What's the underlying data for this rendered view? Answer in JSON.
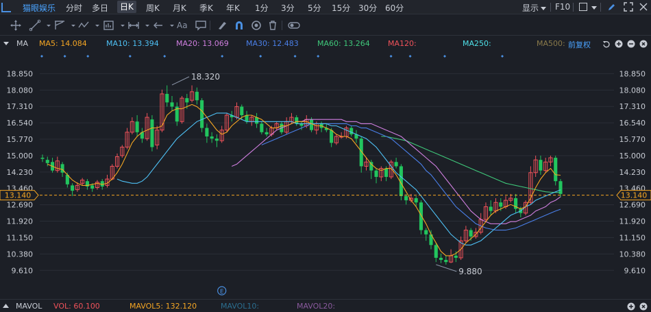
{
  "header": {
    "stock_name": "猫眼娱乐",
    "periods": [
      {
        "label": "分时",
        "active": false
      },
      {
        "label": "多日",
        "active": false
      },
      {
        "label": "日K",
        "active": true
      },
      {
        "label": "周K",
        "active": false
      },
      {
        "label": "月K",
        "active": false
      },
      {
        "label": "季K",
        "active": false
      },
      {
        "label": "年K",
        "active": false
      },
      {
        "label": "1分",
        "active": false
      },
      {
        "label": "3分",
        "active": false
      },
      {
        "label": "5分",
        "active": false
      },
      {
        "label": "15分",
        "active": false
      },
      {
        "label": "30分",
        "active": false
      },
      {
        "label": "60分",
        "active": false
      }
    ],
    "display_label": "显示",
    "f10_label": "F10"
  },
  "toolbar": {
    "tools": [
      "crosshair-icon",
      "line-draw-icon",
      "channel-icon",
      "polyline-icon",
      "measure-icon",
      "range-icon",
      "arrow-icon",
      "text-icon",
      "comment-icon",
      "eraser-icon",
      "magnet-icon",
      "eye-icon",
      "trash-icon",
      "toggle-icon"
    ],
    "text_tool_label": "Aa"
  },
  "ma_legend": {
    "indicator_label": "MA",
    "items": [
      {
        "label": "MA5: 14.084",
        "color": "#f5a623"
      },
      {
        "label": "MA10: 13.394",
        "color": "#4ec1f5"
      },
      {
        "label": "MA20: 13.069",
        "color": "#d07fe0"
      },
      {
        "label": "MA30: 12.483",
        "color": "#4a7fe8"
      },
      {
        "label": "MA60: 13.264",
        "color": "#3fc87a"
      },
      {
        "label": "MA120:",
        "color": "#f0525a"
      },
      {
        "label": "MA250:",
        "color": "#4ee0e8"
      },
      {
        "label": "MA500:",
        "color": "#8a7a4a"
      }
    ],
    "adjust_label": "前复权"
  },
  "volume_legend": {
    "indicator_label": "MAVOL",
    "items": [
      {
        "label": "VOL: 60.100",
        "color": "#f0525a"
      },
      {
        "label": "MAVOL5: 132.120",
        "color": "#f5a623"
      },
      {
        "label": "MAVOL10:",
        "color": "#2b6e8f"
      },
      {
        "label": "MAVOL20:",
        "color": "#8a5a9e"
      }
    ]
  },
  "chart_data": {
    "type": "candlestick",
    "y_ticks": [
      "18.850",
      "18.080",
      "17.310",
      "16.540",
      "15.770",
      "15.000",
      "14.230",
      "13.460",
      "12.690",
      "11.920",
      "11.150",
      "10.380",
      "9.610"
    ],
    "y_tick_values": [
      18.85,
      18.08,
      17.31,
      16.54,
      15.77,
      15.0,
      14.23,
      13.46,
      12.69,
      11.92,
      11.15,
      10.38,
      9.61
    ],
    "ylim": [
      9.2,
      19.25
    ],
    "current_price_label": "13.140",
    "current_price": 13.14,
    "annotations": [
      {
        "label": "18.320",
        "value": 18.32,
        "index": 26
      },
      {
        "label": "9.880",
        "value": 9.88,
        "index": 79
      }
    ],
    "event_marker": {
      "label": "E",
      "index": 36
    },
    "colors": {
      "up": "#f0525a",
      "down": "#22c55e",
      "ma5": "#f5a623",
      "ma10": "#4ec1f5",
      "ma20": "#d07fe0",
      "ma30": "#4a7fe8",
      "ma60": "#3fc87a"
    },
    "candles": [
      [
        14.9,
        14.85,
        15.05,
        14.7
      ],
      [
        14.8,
        14.65,
        14.95,
        14.5
      ],
      [
        14.7,
        14.3,
        14.9,
        14.2
      ],
      [
        14.3,
        14.75,
        14.95,
        14.2
      ],
      [
        14.6,
        14.2,
        14.7,
        14.0
      ],
      [
        14.1,
        13.65,
        14.2,
        13.5
      ],
      [
        13.6,
        13.35,
        13.7,
        13.1
      ],
      [
        13.4,
        13.6,
        13.75,
        13.3
      ],
      [
        13.7,
        13.85,
        13.95,
        13.6
      ],
      [
        13.8,
        13.55,
        13.9,
        13.4
      ],
      [
        13.6,
        13.45,
        13.7,
        13.3
      ],
      [
        13.5,
        13.75,
        13.85,
        13.4
      ],
      [
        13.8,
        13.55,
        13.9,
        13.4
      ],
      [
        13.6,
        13.9,
        14.1,
        13.5
      ],
      [
        13.9,
        14.5,
        14.6,
        13.85
      ],
      [
        14.5,
        14.95,
        15.1,
        14.4
      ],
      [
        15.0,
        15.4,
        15.5,
        14.9
      ],
      [
        15.4,
        16.1,
        16.3,
        15.3
      ],
      [
        16.1,
        16.6,
        16.8,
        16.0
      ],
      [
        16.6,
        16.1,
        16.9,
        15.9
      ],
      [
        16.1,
        15.8,
        16.3,
        15.6
      ],
      [
        15.8,
        16.8,
        17.0,
        15.7
      ],
      [
        16.7,
        15.4,
        16.9,
        15.2
      ],
      [
        15.5,
        16.2,
        16.4,
        15.3
      ],
      [
        16.2,
        17.9,
        18.1,
        16.1
      ],
      [
        17.9,
        17.5,
        18.3,
        17.3
      ],
      [
        17.5,
        17.3,
        17.8,
        17.1
      ],
      [
        17.3,
        16.6,
        17.5,
        16.4
      ],
      [
        16.6,
        17.7,
        17.8,
        16.5
      ],
      [
        17.7,
        17.5,
        17.9,
        17.2
      ],
      [
        17.6,
        18.0,
        18.3,
        17.5
      ],
      [
        18.0,
        17.6,
        18.2,
        17.4
      ],
      [
        17.6,
        16.3,
        17.7,
        16.1
      ],
      [
        16.3,
        15.9,
        16.5,
        15.6
      ],
      [
        15.9,
        15.8,
        16.1,
        15.6
      ],
      [
        15.8,
        15.7,
        16.0,
        15.4
      ],
      [
        15.7,
        16.2,
        16.4,
        15.6
      ],
      [
        16.2,
        16.9,
        17.0,
        16.1
      ],
      [
        16.9,
        16.8,
        17.1,
        16.6
      ],
      [
        16.8,
        17.3,
        17.5,
        16.7
      ],
      [
        17.3,
        16.9,
        17.4,
        16.7
      ],
      [
        16.9,
        16.6,
        17.1,
        16.5
      ],
      [
        16.6,
        16.8,
        16.9,
        16.4
      ],
      [
        16.8,
        16.5,
        17.0,
        16.3
      ],
      [
        16.5,
        16.1,
        16.6,
        16.0
      ],
      [
        16.1,
        16.0,
        16.3,
        15.9
      ],
      [
        16.0,
        16.3,
        16.4,
        15.9
      ],
      [
        16.3,
        16.5,
        16.6,
        16.2
      ],
      [
        16.5,
        16.1,
        16.6,
        16.0
      ],
      [
        16.1,
        16.6,
        16.8,
        16.0
      ],
      [
        16.6,
        16.8,
        17.0,
        16.5
      ],
      [
        16.8,
        16.5,
        16.9,
        16.4
      ],
      [
        16.5,
        16.4,
        16.6,
        16.2
      ],
      [
        16.4,
        16.7,
        16.9,
        16.3
      ],
      [
        16.7,
        16.2,
        16.8,
        16.1
      ],
      [
        16.2,
        16.5,
        16.6,
        16.0
      ],
      [
        16.5,
        16.3,
        16.6,
        16.1
      ],
      [
        16.3,
        16.2,
        16.5,
        16.1
      ],
      [
        16.2,
        15.6,
        16.3,
        15.4
      ],
      [
        15.6,
        15.9,
        16.0,
        15.5
      ],
      [
        15.9,
        15.9,
        16.1,
        15.8
      ],
      [
        15.9,
        16.3,
        16.4,
        15.8
      ],
      [
        16.3,
        16.0,
        16.4,
        15.9
      ],
      [
        16.0,
        15.8,
        16.2,
        15.6
      ],
      [
        15.8,
        14.5,
        15.9,
        14.2
      ],
      [
        14.5,
        14.7,
        14.9,
        14.3
      ],
      [
        14.7,
        14.3,
        14.8,
        13.9
      ],
      [
        14.3,
        14.0,
        14.4,
        13.7
      ],
      [
        14.0,
        14.4,
        14.5,
        13.8
      ],
      [
        14.4,
        14.0,
        14.5,
        13.8
      ],
      [
        14.0,
        14.7,
        14.8,
        13.9
      ],
      [
        14.7,
        14.5,
        14.9,
        14.4
      ],
      [
        14.5,
        13.1,
        14.6,
        12.9
      ],
      [
        13.1,
        12.9,
        13.2,
        12.7
      ],
      [
        12.9,
        13.0,
        13.2,
        12.8
      ],
      [
        13.0,
        12.8,
        13.1,
        12.6
      ],
      [
        12.8,
        11.5,
        12.9,
        11.3
      ],
      [
        11.5,
        11.3,
        11.6,
        11.0
      ],
      [
        11.3,
        10.8,
        11.5,
        10.6
      ],
      [
        10.8,
        10.2,
        10.9,
        10.0
      ],
      [
        10.2,
        10.1,
        10.4,
        9.95
      ],
      [
        10.1,
        10.0,
        10.3,
        9.88
      ],
      [
        10.0,
        10.3,
        10.6,
        9.95
      ],
      [
        10.3,
        10.2,
        10.5,
        10.0
      ],
      [
        10.2,
        11.0,
        11.2,
        10.1
      ],
      [
        11.0,
        11.5,
        11.7,
        10.9
      ],
      [
        11.5,
        11.2,
        11.6,
        11.0
      ],
      [
        11.2,
        11.4,
        11.6,
        11.1
      ],
      [
        11.4,
        12.0,
        12.3,
        11.3
      ],
      [
        12.0,
        12.6,
        12.8,
        11.9
      ],
      [
        12.6,
        12.4,
        12.9,
        12.2
      ],
      [
        12.4,
        12.8,
        13.0,
        12.3
      ],
      [
        12.8,
        12.6,
        13.0,
        12.4
      ],
      [
        12.6,
        12.9,
        13.1,
        12.5
      ],
      [
        12.9,
        13.0,
        13.2,
        12.8
      ],
      [
        13.0,
        12.5,
        13.2,
        12.3
      ],
      [
        12.5,
        12.3,
        12.6,
        12.1
      ],
      [
        12.3,
        12.8,
        12.9,
        12.2
      ],
      [
        12.8,
        14.2,
        14.5,
        12.7
      ],
      [
        14.2,
        14.8,
        15.0,
        14.0
      ],
      [
        14.8,
        14.3,
        15.0,
        14.1
      ],
      [
        14.3,
        14.7,
        14.9,
        14.2
      ],
      [
        14.7,
        14.9,
        15.0,
        14.5
      ],
      [
        14.9,
        13.8,
        15.0,
        13.6
      ],
      [
        13.8,
        13.2,
        13.9,
        13.05
      ]
    ],
    "ma5": [
      14.6,
      14.5,
      14.4,
      14.35,
      14.1,
      13.85,
      13.7,
      13.6,
      13.6,
      13.65,
      13.7,
      13.65,
      13.7,
      13.9,
      14.2,
      14.6,
      15.1,
      15.6,
      15.9,
      16.1,
      16.2,
      16.3,
      16.3,
      16.4,
      16.9,
      17.1,
      17.2,
      17.2,
      17.3,
      17.4,
      17.3,
      17.1,
      16.8,
      16.5,
      16.2,
      16.0,
      16.1,
      16.4,
      16.6,
      16.8,
      16.9,
      16.9,
      16.8,
      16.7,
      16.5,
      16.3,
      16.3,
      16.4,
      16.4,
      16.5,
      16.6,
      16.6,
      16.6,
      16.5,
      16.4,
      16.4,
      16.3,
      16.2,
      16.0,
      15.9,
      15.9,
      15.8,
      15.5,
      15.2,
      14.9,
      14.6,
      14.4,
      14.3,
      14.4,
      14.4,
      14.1,
      13.7,
      13.3,
      12.9,
      12.6,
      12.2,
      11.8,
      11.3,
      10.9,
      10.5,
      10.3,
      10.3,
      10.4,
      10.6,
      10.9,
      11.1,
      11.3,
      11.6,
      11.9,
      12.2,
      12.4,
      12.5,
      12.6,
      12.7,
      12.6,
      12.5,
      12.6,
      13.0,
      13.5,
      13.9,
      14.2,
      14.4,
      14.1,
      14.08
    ],
    "ma10": [
      null,
      null,
      null,
      null,
      null,
      null,
      null,
      null,
      null,
      13.9,
      13.8,
      13.75,
      13.7,
      13.7,
      13.8,
      14.0,
      14.3,
      14.6,
      14.9,
      15.2,
      15.5,
      15.8,
      16.0,
      16.2,
      16.4,
      16.6,
      16.7,
      16.8,
      16.9,
      17.0,
      17.0,
      17.0,
      16.9,
      16.8,
      16.7,
      16.6,
      16.6,
      16.6,
      16.6,
      16.6,
      16.6,
      16.6,
      16.6,
      16.6,
      16.6,
      16.5,
      16.5,
      16.5,
      16.5,
      16.5,
      16.5,
      16.5,
      16.4,
      16.4,
      16.3,
      16.2,
      16.1,
      16.0,
      15.9,
      15.8,
      15.6,
      15.4,
      15.1,
      14.8,
      14.5,
      14.2,
      14.0,
      13.8,
      13.6,
      13.4,
      13.1,
      12.8,
      12.5,
      12.2,
      11.9,
      11.6,
      11.3,
      11.1,
      10.9,
      10.8,
      10.8,
      10.9,
      11.0,
      11.2,
      11.4,
      11.6,
      11.8,
      12.0,
      12.2,
      12.3,
      12.4,
      12.6,
      12.7,
      12.9,
      13.0,
      13.1,
      13.2,
      13.3,
      13.39
    ],
    "ma20": [
      null,
      null,
      null,
      null,
      null,
      null,
      null,
      null,
      null,
      null,
      null,
      null,
      null,
      null,
      null,
      null,
      null,
      null,
      null,
      14.5,
      14.6,
      14.8,
      15.0,
      15.2,
      15.4,
      15.6,
      15.8,
      16.0,
      16.2,
      16.3,
      16.4,
      16.5,
      16.6,
      16.6,
      16.7,
      16.7,
      16.7,
      16.7,
      16.7,
      16.7,
      16.7,
      16.7,
      16.6,
      16.6,
      16.6,
      16.5,
      16.5,
      16.5,
      16.4,
      16.3,
      16.2,
      16.1,
      16.0,
      15.9,
      15.7,
      15.5,
      15.3,
      15.1,
      14.9,
      14.7,
      14.5,
      14.2,
      13.9,
      13.6,
      13.3,
      13.0,
      12.7,
      12.4,
      12.2,
      12.0,
      11.9,
      11.8,
      11.8,
      11.8,
      11.8,
      11.9,
      11.9,
      12.0,
      12.1,
      12.2,
      12.4,
      12.5,
      12.6,
      12.8,
      12.9,
      13.07
    ],
    "ma30": [
      null,
      null,
      null,
      null,
      null,
      null,
      null,
      null,
      null,
      null,
      null,
      null,
      null,
      null,
      null,
      null,
      null,
      null,
      null,
      null,
      null,
      null,
      null,
      null,
      null,
      null,
      null,
      null,
      null,
      15.5,
      15.6,
      15.7,
      15.8,
      15.9,
      16.0,
      16.1,
      16.2,
      16.3,
      16.4,
      16.5,
      16.5,
      16.5,
      16.5,
      16.5,
      16.5,
      16.5,
      16.5,
      16.4,
      16.4,
      16.3,
      16.3,
      16.2,
      16.1,
      16.0,
      15.9,
      15.8,
      15.6,
      15.4,
      15.2,
      15.0,
      14.8,
      14.6,
      14.3,
      14.1,
      13.8,
      13.5,
      13.2,
      12.9,
      12.6,
      12.4,
      12.2,
      12.0,
      11.8,
      11.7,
      11.6,
      11.55,
      11.5,
      11.5,
      11.5,
      11.55,
      11.6,
      11.7,
      11.8,
      11.9,
      12.0,
      12.1,
      12.2,
      12.3,
      12.4,
      12.483
    ],
    "ma60": [
      null,
      null,
      null,
      null,
      null,
      null,
      null,
      null,
      null,
      null,
      null,
      null,
      null,
      null,
      null,
      null,
      null,
      null,
      null,
      null,
      null,
      null,
      null,
      null,
      null,
      null,
      null,
      null,
      null,
      null,
      null,
      null,
      null,
      null,
      null,
      null,
      null,
      null,
      null,
      null,
      null,
      null,
      null,
      null,
      null,
      null,
      null,
      null,
      null,
      null,
      null,
      null,
      null,
      null,
      null,
      null,
      null,
      null,
      null,
      15.9,
      15.9,
      15.85,
      15.8,
      15.75,
      15.7,
      15.6,
      15.5,
      15.4,
      15.3,
      15.2,
      15.1,
      15.0,
      14.9,
      14.8,
      14.7,
      14.6,
      14.5,
      14.4,
      14.3,
      14.2,
      14.1,
      14.0,
      13.9,
      13.8,
      13.7,
      13.65,
      13.6,
      13.55,
      13.5,
      13.45,
      13.4,
      13.35,
      13.3,
      13.28,
      13.27,
      13.264
    ]
  }
}
